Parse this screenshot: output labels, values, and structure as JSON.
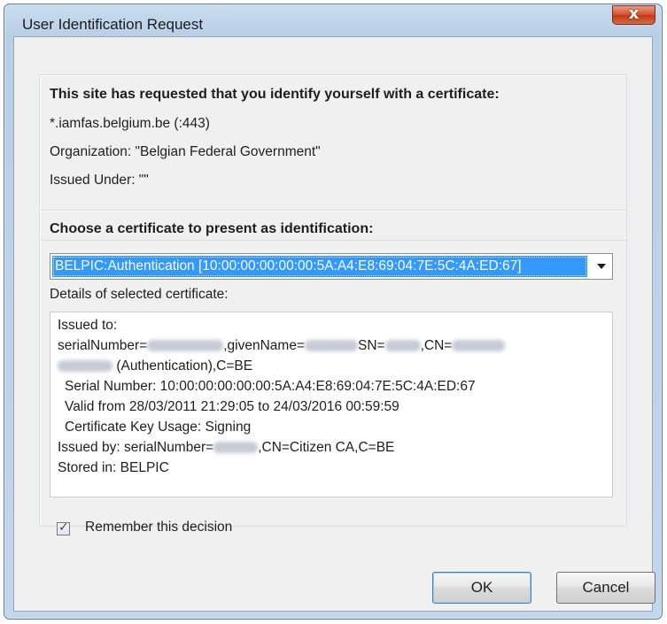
{
  "window": {
    "title": "User Identification Request",
    "close_label": "x"
  },
  "request": {
    "heading": "This site has requested that you identify yourself with a certificate:",
    "host": "*.iamfas.belgium.be (:443)",
    "organization": "Organization: \"Belgian Federal Government\"",
    "issued_under": "Issued Under: \"\""
  },
  "certificate": {
    "choose_label": "Choose a certificate to present as identification:",
    "selected": "BELPIC:Authentication [10:00:00:00:00:00:5A:A4:E8:69:04:7E:5C:4A:ED:67]",
    "details_label": "Details of selected certificate:"
  },
  "details": {
    "line1": "Issued to:",
    "line2_a": "serialNumber=",
    "line2_b": ",givenName=",
    "line2_c": "SN=",
    "line2_d": ",CN=",
    "line3": "(Authentication),C=BE",
    "line4": "Serial Number: 10:00:00:00:00:00:5A:A4:E8:69:04:7E:5C:4A:ED:67",
    "line5": "Valid from 28/03/2011 21:29:05 to 24/03/2016 00:59:59",
    "line6": "Certificate Key Usage: Signing",
    "line7_a": "Issued by: serialNumber=",
    "line7_b": ",CN=Citizen CA,C=BE",
    "line8": "Stored in: BELPIC"
  },
  "remember": {
    "label": "Remember this decision",
    "checked": true
  },
  "buttons": {
    "ok": "OK",
    "cancel": "Cancel"
  }
}
